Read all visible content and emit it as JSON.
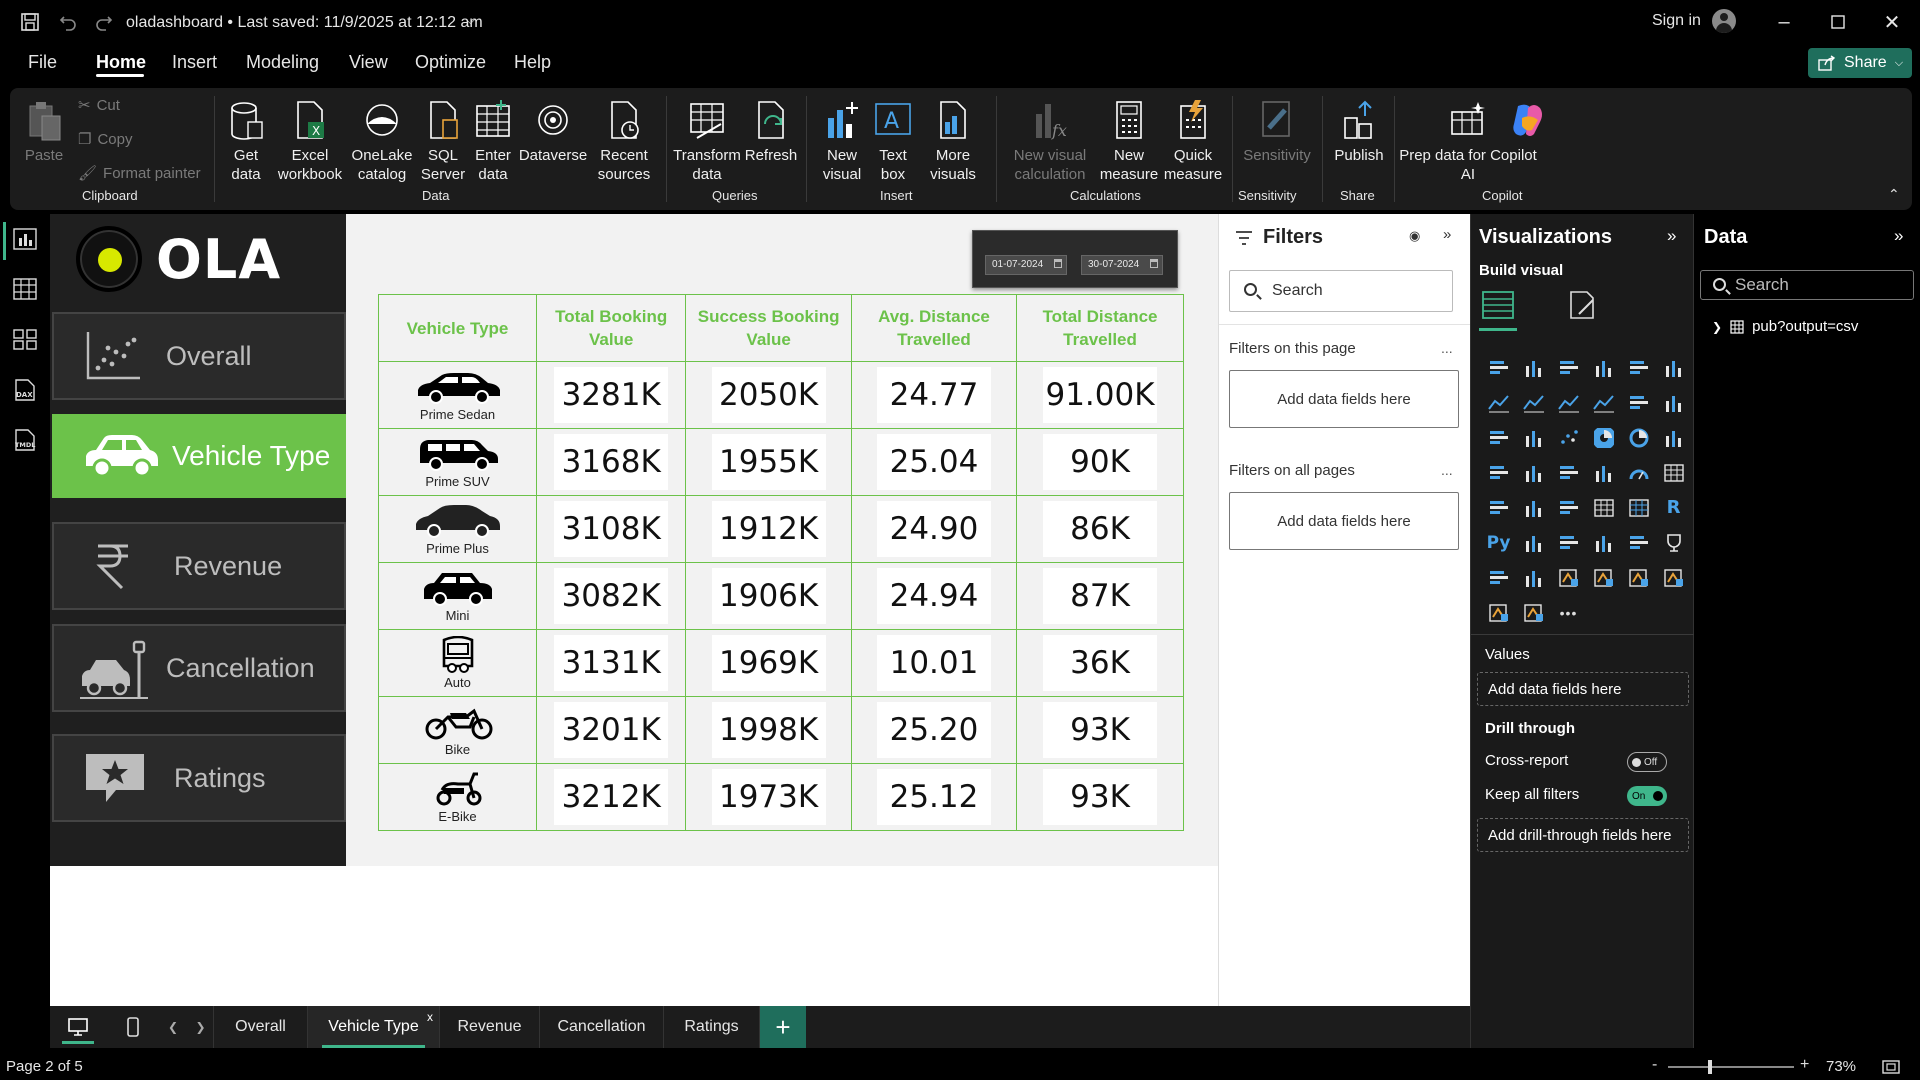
{
  "titlebar": {
    "title": "oladashboard • Last saved: 11/9/2025 at 12:12 am",
    "sign_in": "Sign in"
  },
  "menu": {
    "items": [
      "File",
      "Home",
      "Insert",
      "Modeling",
      "View",
      "Optimize",
      "Help"
    ],
    "active": "Home",
    "share": "Share"
  },
  "ribbon": {
    "clipboard": {
      "paste": "Paste",
      "cut": "Cut",
      "copy": "Copy",
      "format_painter": "Format painter",
      "group": "Clipboard"
    },
    "data": {
      "get_data": "Get data",
      "excel": "Excel workbook",
      "onelake": "OneLake catalog",
      "sql": "SQL Server",
      "enter_data": "Enter data",
      "dataverse": "Dataverse",
      "recent": "Recent sources",
      "group": "Data"
    },
    "queries": {
      "transform": "Transform data",
      "refresh": "Refresh",
      "group": "Queries"
    },
    "insert": {
      "new_visual": "New visual",
      "text_box": "Text box",
      "more_visuals": "More visuals",
      "group": "Insert"
    },
    "calculations": {
      "new_visual_calc": "New visual calculation",
      "new_measure": "New measure",
      "quick_measure": "Quick measure",
      "group": "Calculations"
    },
    "sensitivity": {
      "label": "Sensitivity",
      "group": "Sensitivity"
    },
    "share": {
      "publish": "Publish",
      "group": "Share"
    },
    "copilot": {
      "prep": "Prep data for Copilot AI",
      "copilot": "Copilot",
      "group": "Copilot"
    }
  },
  "nav": {
    "logo_text": "OLA",
    "buttons": [
      "Overall",
      "Vehicle Type",
      "Revenue",
      "Cancellation",
      "Ratings"
    ],
    "active": "Vehicle Type"
  },
  "date_slicer": {
    "start": "01-07-2024",
    "end": "30-07-2024"
  },
  "table": {
    "headers": [
      "Vehicle Type",
      "Total Booking Value",
      "Success Booking Value",
      "Avg. Distance Travelled",
      "Total Distance Travelled"
    ],
    "rows": [
      {
        "vehicle": "Prime Sedan",
        "total_booking": "3281K",
        "success_booking": "2050K",
        "avg_distance": "24.77",
        "total_distance": "91.00K"
      },
      {
        "vehicle": "Prime SUV",
        "total_booking": "3168K",
        "success_booking": "1955K",
        "avg_distance": "25.04",
        "total_distance": "90K"
      },
      {
        "vehicle": "Prime Plus",
        "total_booking": "3108K",
        "success_booking": "1912K",
        "avg_distance": "24.90",
        "total_distance": "86K"
      },
      {
        "vehicle": "Mini",
        "total_booking": "3082K",
        "success_booking": "1906K",
        "avg_distance": "24.94",
        "total_distance": "87K"
      },
      {
        "vehicle": "Auto",
        "total_booking": "3131K",
        "success_booking": "1969K",
        "avg_distance": "10.01",
        "total_distance": "36K"
      },
      {
        "vehicle": "Bike",
        "total_booking": "3201K",
        "success_booking": "1998K",
        "avg_distance": "25.20",
        "total_distance": "93K"
      },
      {
        "vehicle": "E-Bike",
        "total_booking": "3212K",
        "success_booking": "1973K",
        "avg_distance": "25.12",
        "total_distance": "93K"
      }
    ]
  },
  "filters": {
    "title": "Filters",
    "search_placeholder": "Search",
    "on_this_page": "Filters on this page",
    "on_all_pages": "Filters on all pages",
    "add_fields": "Add data fields here",
    "more": "..."
  },
  "visualizations": {
    "title": "Visualizations",
    "build_visual": "Build visual",
    "values_label": "Values",
    "values_well": "Add data fields here",
    "drill_through": "Drill through",
    "cross_report": "Cross-report",
    "cross_report_state": "Off",
    "keep_filters": "Keep all filters",
    "keep_filters_state": "On",
    "drill_well": "Add drill-through fields here"
  },
  "data_panel": {
    "title": "Data",
    "search_placeholder": "Search",
    "table_name": "pub?output=csv"
  },
  "page_tabs": {
    "tabs": [
      "Overall",
      "Vehicle Type",
      "Revenue",
      "Cancellation",
      "Ratings"
    ],
    "active": "Vehicle Type",
    "close": "x",
    "add": "+"
  },
  "status": {
    "page": "Page 2 of 5",
    "zoom": "73%"
  },
  "colors": {
    "accent_green": "#6cc24a",
    "brand_teal": "#1f6e5c",
    "ola_yellow": "#d7e800"
  }
}
